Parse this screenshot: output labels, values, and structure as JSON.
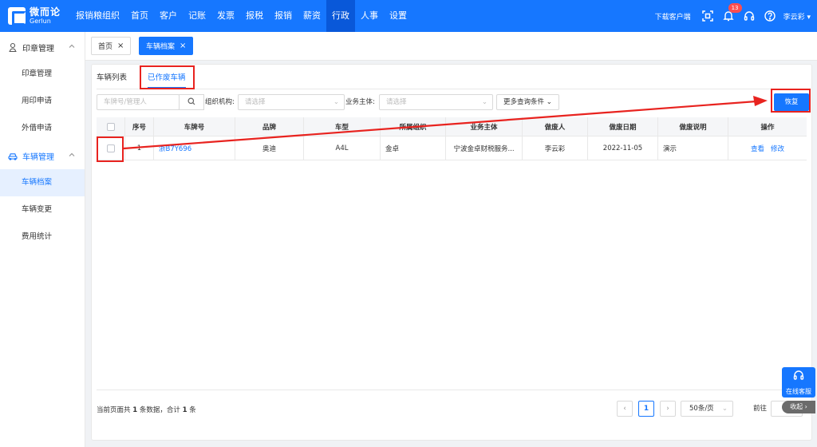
{
  "app": {
    "logo_cn": "微而论",
    "logo_en": "Gerlun"
  },
  "topnav": [
    {
      "label": "报销粮组织"
    },
    {
      "label": "首页"
    },
    {
      "label": "客户"
    },
    {
      "label": "记账"
    },
    {
      "label": "发票"
    },
    {
      "label": "报税"
    },
    {
      "label": "报销"
    },
    {
      "label": "薪资"
    },
    {
      "label": "行政"
    },
    {
      "label": "人事"
    },
    {
      "label": "设置"
    }
  ],
  "topbar": {
    "download": "下载客户端",
    "notif_count": "13",
    "user": "李云彩"
  },
  "sidebar": {
    "groups": [
      {
        "label": "印章管理",
        "items": [
          "印章管理",
          "用印申请",
          "外借申请"
        ]
      },
      {
        "label": "车辆管理",
        "items": [
          "车辆档案",
          "车辆变更",
          "费用统计"
        ]
      }
    ]
  },
  "page_tabs": [
    {
      "label": "首页"
    },
    {
      "label": "车辆档案"
    }
  ],
  "sub_tabs": [
    {
      "label": "车辆列表"
    },
    {
      "label": "已作废车辆"
    }
  ],
  "filters": {
    "search_placeholder": "车牌号/管理人",
    "org_label": "组织机构:",
    "org_placeholder": "请选择",
    "entity_label": "业务主体:",
    "entity_placeholder": "请选择",
    "more_label": "更多查询条件",
    "restore_label": "恢复"
  },
  "table": {
    "columns": [
      "序号",
      "车牌号",
      "品牌",
      "车型",
      "所属组织",
      "业务主体",
      "做废人",
      "做废日期",
      "做废说明",
      "操作"
    ],
    "rows": [
      {
        "index": "1",
        "plate": "浙B7Y696",
        "brand": "奥迪",
        "model": "A4L",
        "org": "金卓",
        "entity": "宁波金卓财税服务...",
        "voided_by": "李云彩",
        "voided_date": "2022-11-05",
        "remark": "演示",
        "action_view": "查看",
        "action_edit": "修改"
      }
    ]
  },
  "pagination": {
    "summary_prefix": "当前页面共",
    "page_count": "1",
    "summary_mid": "条数据，合计",
    "total": "1",
    "summary_suffix": "条",
    "current_page": "1",
    "page_size": "50条/页",
    "goto_label": "前往"
  },
  "widgets": {
    "cs_label": "在线客服",
    "collapse_label": "收起"
  }
}
